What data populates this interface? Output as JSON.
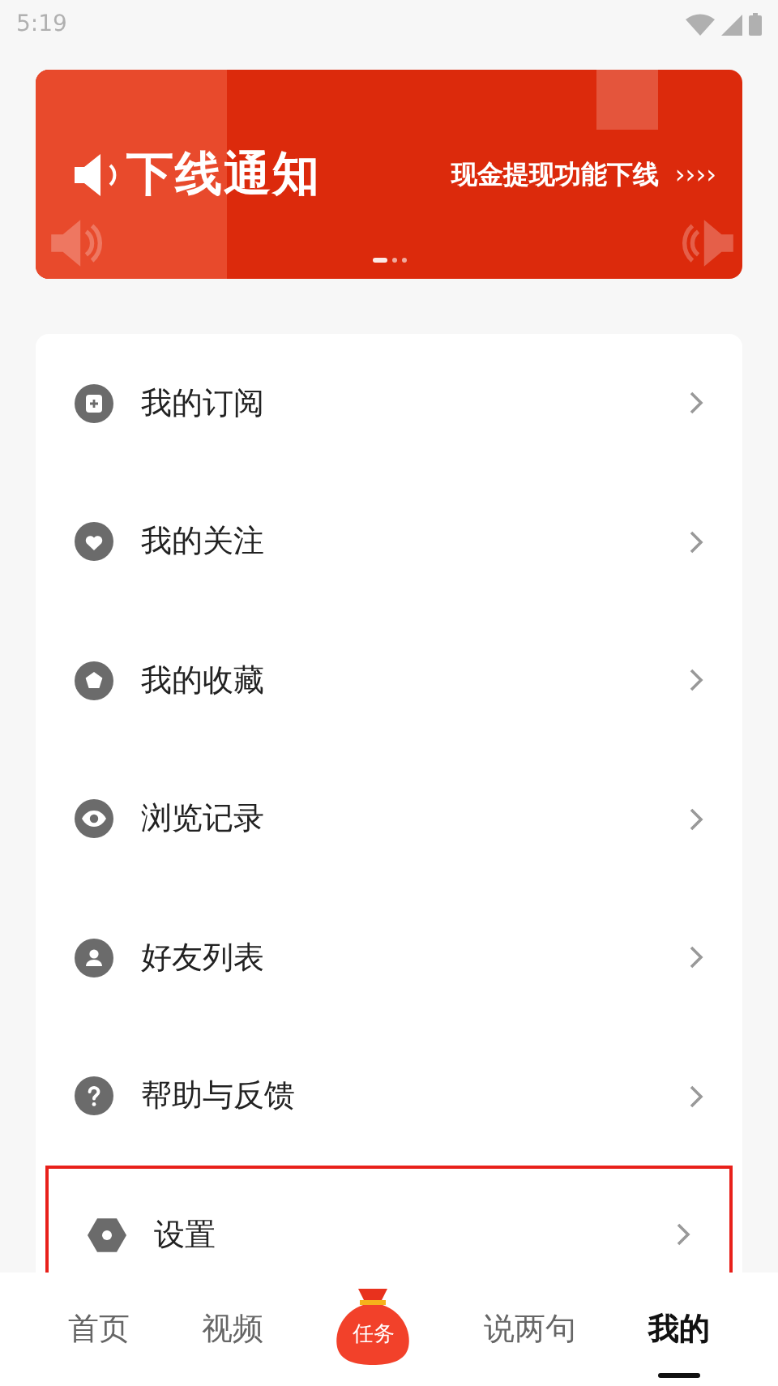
{
  "status_bar": {
    "time": "5:19"
  },
  "banner": {
    "title": "下线通知",
    "subtitle": "现金提现功能下线",
    "arrows": "››››",
    "dots": [
      {
        "selected": true
      },
      {
        "selected": false
      },
      {
        "selected": false
      }
    ]
  },
  "menu": [
    {
      "label": "我的订阅",
      "highlighted": false
    },
    {
      "label": "我的关注",
      "highlighted": false
    },
    {
      "label": "我的收藏",
      "highlighted": false
    },
    {
      "label": "浏览记录",
      "highlighted": false
    },
    {
      "label": "好友列表",
      "highlighted": false
    },
    {
      "label": "帮助与反馈",
      "highlighted": false
    },
    {
      "label": "设置",
      "highlighted": true
    }
  ],
  "tabs": [
    {
      "label": "首页",
      "selected": false,
      "kind": "text"
    },
    {
      "label": "视频",
      "selected": false,
      "kind": "text"
    },
    {
      "label": "任务",
      "selected": false,
      "kind": "bag"
    },
    {
      "label": "说两句",
      "selected": false,
      "kind": "text"
    },
    {
      "label": "我的",
      "selected": true,
      "kind": "text"
    }
  ]
}
